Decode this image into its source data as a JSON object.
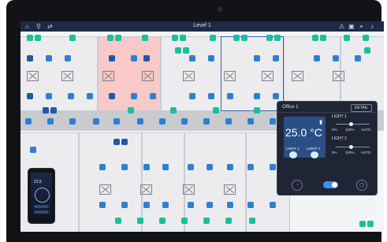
{
  "topbar": {
    "title": "Level 1",
    "icons": [
      "home-icon",
      "profile-icon",
      "swap-icon",
      "warning-icon",
      "camera-icon",
      "location-icon",
      "bell-icon"
    ]
  },
  "panel": {
    "title": "Office 1",
    "detail_button": "DETAIL",
    "temperature": "25.0 °C",
    "light_labels": [
      "LIGHT 1",
      "LIGHT 2"
    ],
    "control_light1": "LIGHT 1",
    "control_light2": "LIGHT 2",
    "scale_values": [
      "0%",
      "100%",
      "AUTO"
    ],
    "bottom_buttons": [
      "scene-icon",
      "off-icon"
    ]
  },
  "colors": {
    "accent_blue": "#2a4f86",
    "sensor_green": "#1bbf9a",
    "sensor_blue": "#1f5aa6",
    "selection_red": "#f7c9c9",
    "selection_blue": "#3c5fb0",
    "topbar": "#1e2a44"
  },
  "phone": {
    "temperature": "21.5"
  }
}
